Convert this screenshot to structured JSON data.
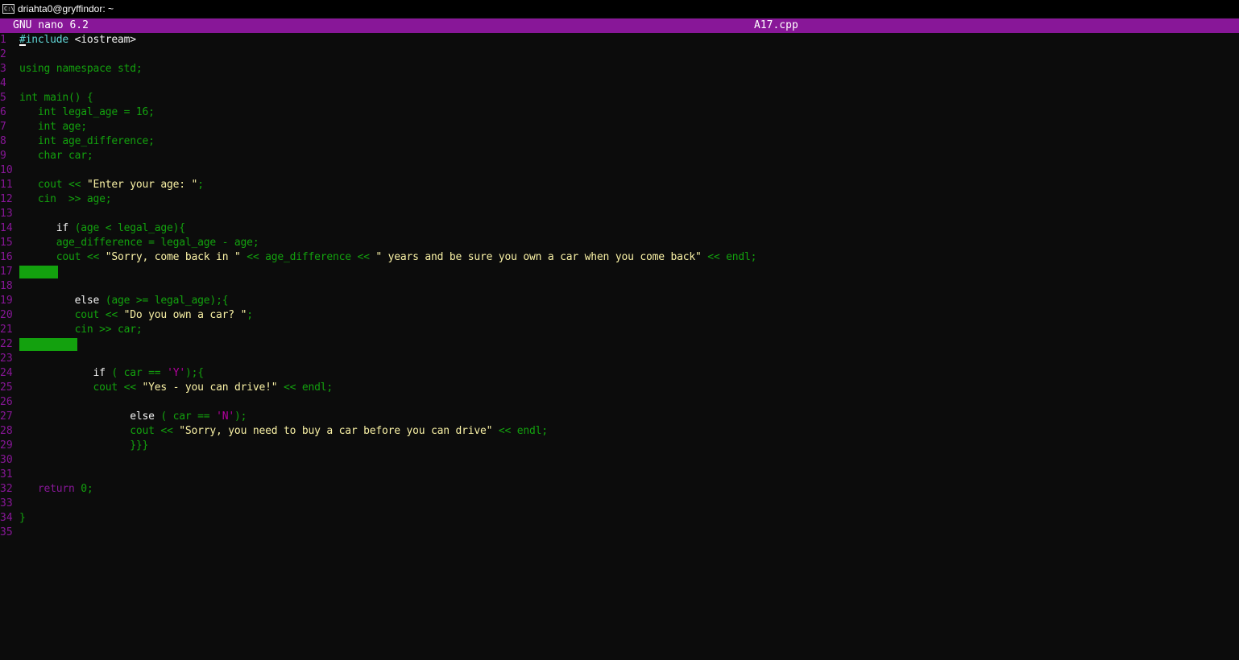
{
  "window": {
    "title": "driahta0@gryffindor: ~",
    "icon": "console-icon",
    "icon_glyph": "C:\\"
  },
  "nano": {
    "version": "GNU nano 6.2",
    "filename": "A17.cpp",
    "header_color": "#881798"
  },
  "colors": {
    "background": "#0c0c0c",
    "line_number": "#881798",
    "keyword_green": "#13a10e",
    "string_yellow": "#f9f1a5",
    "char_magenta": "#b4009e",
    "whitespace_highlight": "#13a10e"
  },
  "lines": [
    {
      "n": "1",
      "segs": [
        {
          "t": "#include",
          "c": "lcyan"
        },
        {
          "t": " <iostream>",
          "c": "bwhite"
        }
      ]
    },
    {
      "n": "2",
      "segs": []
    },
    {
      "n": "3",
      "segs": [
        {
          "t": "using namespace std;",
          "c": "green"
        }
      ]
    },
    {
      "n": "4",
      "segs": []
    },
    {
      "n": "5",
      "segs": [
        {
          "t": "int main() {",
          "c": "green"
        }
      ]
    },
    {
      "n": "6",
      "segs": [
        {
          "t": "   int legal_age = 16;",
          "c": "green"
        }
      ]
    },
    {
      "n": "7",
      "segs": [
        {
          "t": "   int age;",
          "c": "green"
        }
      ]
    },
    {
      "n": "8",
      "segs": [
        {
          "t": "   int age_difference;",
          "c": "green"
        }
      ]
    },
    {
      "n": "9",
      "segs": [
        {
          "t": "   char car;",
          "c": "green"
        }
      ]
    },
    {
      "n": "10",
      "segs": []
    },
    {
      "n": "11",
      "segs": [
        {
          "t": "   cout << ",
          "c": "green"
        },
        {
          "t": "\"Enter your age: \"",
          "c": "yellow"
        },
        {
          "t": ";",
          "c": "green"
        }
      ]
    },
    {
      "n": "12",
      "segs": [
        {
          "t": "   cin  >> age;",
          "c": "green"
        }
      ]
    },
    {
      "n": "13",
      "segs": []
    },
    {
      "n": "14",
      "segs": [
        {
          "t": "      if",
          "c": "bwhite"
        },
        {
          "t": " (age < legal_age){",
          "c": "green"
        }
      ]
    },
    {
      "n": "15",
      "segs": [
        {
          "t": "      age_difference = legal_age - age;",
          "c": "green"
        }
      ]
    },
    {
      "n": "16",
      "segs": [
        {
          "t": "      cout << ",
          "c": "green"
        },
        {
          "t": "\"Sorry, come back in \"",
          "c": "yellow"
        },
        {
          "t": " << age_difference << ",
          "c": "green"
        },
        {
          "t": "\" years and be sure you own a car when you come back\"",
          "c": "yellow"
        },
        {
          "t": " << endl;",
          "c": "green"
        }
      ]
    },
    {
      "n": "17",
      "segs": [],
      "fill_chars": 6
    },
    {
      "n": "18",
      "segs": []
    },
    {
      "n": "19",
      "segs": [
        {
          "t": "         else",
          "c": "bwhite"
        },
        {
          "t": " (age >= legal_age);{",
          "c": "green"
        }
      ]
    },
    {
      "n": "20",
      "segs": [
        {
          "t": "         cout << ",
          "c": "green"
        },
        {
          "t": "\"Do you own a car? \"",
          "c": "yellow"
        },
        {
          "t": ";",
          "c": "green"
        }
      ]
    },
    {
      "n": "21",
      "segs": [
        {
          "t": "         cin >> car;",
          "c": "green"
        }
      ]
    },
    {
      "n": "22",
      "segs": [],
      "fill_chars": 9
    },
    {
      "n": "23",
      "segs": []
    },
    {
      "n": "24",
      "segs": [
        {
          "t": "            if",
          "c": "bwhite"
        },
        {
          "t": " ( car == ",
          "c": "green"
        },
        {
          "t": "'Y'",
          "c": "magenta"
        },
        {
          "t": ");{",
          "c": "green"
        }
      ]
    },
    {
      "n": "25",
      "segs": [
        {
          "t": "            cout << ",
          "c": "green"
        },
        {
          "t": "\"Yes - you can drive!\"",
          "c": "yellow"
        },
        {
          "t": " << endl;",
          "c": "green"
        }
      ]
    },
    {
      "n": "26",
      "segs": []
    },
    {
      "n": "27",
      "segs": [
        {
          "t": "                  else",
          "c": "bwhite"
        },
        {
          "t": " ( car == ",
          "c": "green"
        },
        {
          "t": "'N'",
          "c": "magenta"
        },
        {
          "t": ");",
          "c": "green"
        }
      ]
    },
    {
      "n": "28",
      "segs": [
        {
          "t": "                  cout << ",
          "c": "green"
        },
        {
          "t": "\"Sorry, you need to buy a car before you can drive\"",
          "c": "yellow"
        },
        {
          "t": " << endl;",
          "c": "green"
        }
      ]
    },
    {
      "n": "29",
      "segs": [
        {
          "t": "                  }}}",
          "c": "green"
        }
      ]
    },
    {
      "n": "30",
      "segs": []
    },
    {
      "n": "31",
      "segs": []
    },
    {
      "n": "32",
      "segs": [
        {
          "t": "   return",
          "c": "dmagenta"
        },
        {
          "t": " 0;",
          "c": "green"
        }
      ]
    },
    {
      "n": "33",
      "segs": []
    },
    {
      "n": "34",
      "segs": [
        {
          "t": "}",
          "c": "green"
        }
      ]
    },
    {
      "n": "35",
      "segs": []
    }
  ]
}
